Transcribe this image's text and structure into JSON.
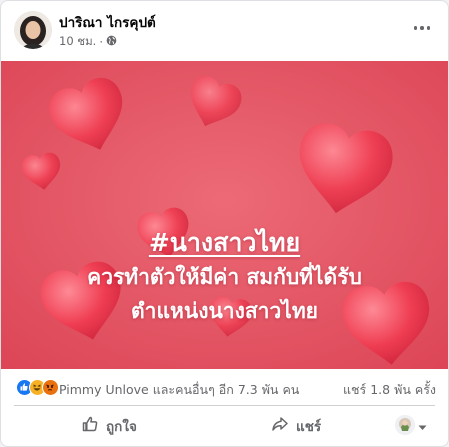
{
  "post": {
    "author": "ปาริณา ไกรคุปต์",
    "timestamp": "10 ชม.",
    "separator": "·",
    "privacy_icon": "globe-icon",
    "more_icon": "more-options-icon"
  },
  "image": {
    "hashtag": "#นางสาวไทย",
    "line1": "ควรทำตัวให้มีค่า สมกับที่ได้รับ",
    "line2": "ตำแหน่งนางสาวไทย",
    "background_color": "#e24b5b",
    "heart_color": "#ef3b4f"
  },
  "stats": {
    "reaction_icons": [
      "like-reaction-icon",
      "haha-reaction-icon",
      "angry-reaction-icon"
    ],
    "reactors_text": "Pimmy Unlove และคนอื่นๆ อีก 7.3 พัน คน",
    "shares_text": "แชร์ 1.8 พัน ครั้ง"
  },
  "actions": {
    "like_label": "ถูกใจ",
    "share_label": "แชร์"
  },
  "colors": {
    "like_blue": "#1877f2",
    "text_secondary": "#65676b"
  }
}
